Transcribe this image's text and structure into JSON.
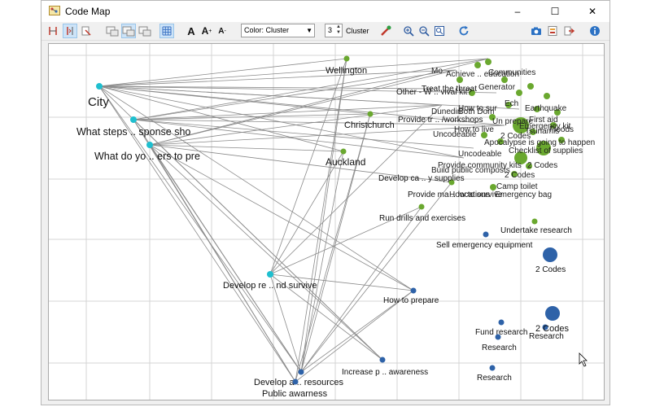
{
  "window": {
    "title": "Code Map",
    "buttons": {
      "minimize": "–",
      "maximize": "☐",
      "close": "✕"
    }
  },
  "toolbar": {
    "font_labels": [
      "A",
      "A",
      "A"
    ],
    "color_select": "Color: Cluster",
    "cluster_count": "3",
    "cluster_label": "Cluster"
  },
  "map": {
    "nodes": [
      {
        "label": "City",
        "color": "#1fbfcf",
        "size": "xl"
      },
      {
        "label": "What steps .. sponse sho",
        "color": "#1fbfcf",
        "size": "l"
      },
      {
        "label": "What do yo .. ers to pre",
        "color": "#1fbfcf",
        "size": "l"
      },
      {
        "label": "Develop re .. nd survive",
        "color": "#1fbfcf",
        "size": "m"
      },
      {
        "label": "Wellington",
        "color": "#6aa82f",
        "size": "m"
      },
      {
        "label": "Christchurch",
        "color": "#6aa82f",
        "size": "m"
      },
      {
        "label": "Auckland",
        "color": "#6aa82f",
        "size": "l"
      },
      {
        "label": "Run drills and exercises",
        "color": "#6aa82f",
        "size": "m"
      },
      {
        "label": "Treat the threat",
        "color": "#6aa82f",
        "size": "m"
      },
      {
        "label": "Other - W .. vival kit?",
        "color": "#6aa82f",
        "size": "m"
      },
      {
        "label": "Provide tr .. /workshops",
        "color": "#6aa82f",
        "size": "m"
      },
      {
        "label": "Develop ca .. y supplies",
        "color": "#6aa82f",
        "size": "m"
      },
      {
        "label": "Provide ma .. locations",
        "color": "#6aa82f",
        "size": "m"
      },
      {
        "label": "Undertake research",
        "color": "#6aa82f",
        "size": "m"
      },
      {
        "label": "Sell emergency equipment",
        "color": "#2e62a8",
        "size": "m"
      },
      {
        "label": "How to prepare",
        "color": "#2e62a8",
        "size": "m"
      },
      {
        "label": "Fund research",
        "color": "#2e62a8",
        "size": "m"
      },
      {
        "label": "Research",
        "color": "#2e62a8",
        "size": "m"
      },
      {
        "label": "Research",
        "color": "#2e62a8",
        "size": "m"
      },
      {
        "label": "Research",
        "color": "#2e62a8",
        "size": "m"
      },
      {
        "label": "Increase p .. awareness",
        "color": "#2e62a8",
        "size": "m"
      },
      {
        "label": "Develop a .. resources",
        "color": "#2e62a8",
        "size": "m"
      },
      {
        "label": "Public awarness",
        "color": "#2e62a8",
        "size": "m"
      },
      {
        "label": "2 Codes",
        "color": "#2e62a8",
        "size": "m"
      },
      {
        "label": "2 Codes",
        "color": "#2e62a8",
        "size": "m"
      }
    ],
    "cluster_texts": [
      "Mo",
      "Achieve .. education",
      "Communities",
      "Generator",
      "Dunedin",
      "Both Dom",
      "How to sur",
      "Ech",
      "Earthquake",
      "First aid",
      "Un prepare",
      "Uncodeable",
      "How to live",
      "2 Codes",
      "Tsunamis",
      "Emergency kit",
      "Floods",
      "Apocalypse is going to happen",
      "Checklist of supplies",
      "Uncodeable",
      "2 Codes",
      "Provide community kits",
      "Build public composts",
      "2 Codes",
      "Camp toilet",
      "How to survive",
      "Emergency bag"
    ]
  }
}
